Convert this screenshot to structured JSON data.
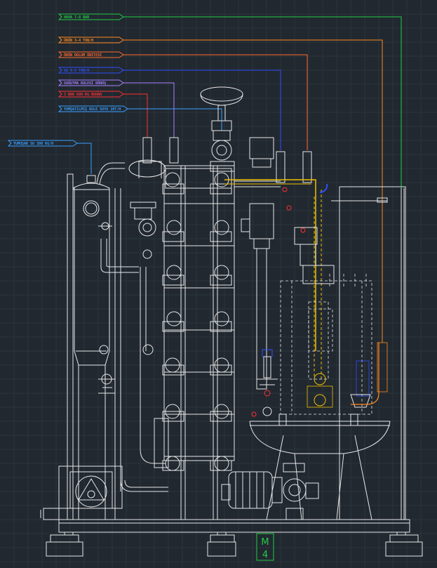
{
  "diagram": {
    "callouts": [
      {
        "text": "HAVA 7-8 BAR",
        "color": "#22cc44"
      },
      {
        "text": "ÜRÜN 3-4 TON/H",
        "color": "#ff8a1c"
      },
      {
        "text": "ÖRÜN DOLUM ÜNİTESİ",
        "color": "#ff6a2a"
      },
      {
        "text": "SU 4-5 TON/H",
        "color": "#3050ff"
      },
      {
        "text": "SOĞUTMA KULESİ DÖNÜŞ",
        "color": "#a880ff"
      },
      {
        "text": "3 BAR 600 KG BUHAR",
        "color": "#ff3030"
      },
      {
        "text": "YUMŞATILMIŞ KULE SUYU 10T/H",
        "color": "#3aa0ff"
      },
      {
        "text": "YUMUŞAK SU 300 KG/H",
        "color": "#3aa0ff"
      }
    ],
    "motor_label": {
      "letter": "M",
      "number": "4"
    }
  }
}
